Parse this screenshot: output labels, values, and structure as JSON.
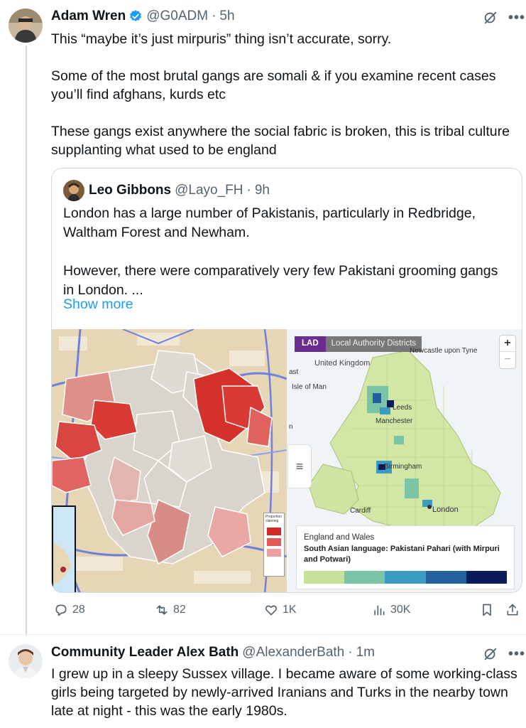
{
  "tweet": {
    "author_name": "Adam Wren",
    "handle": "@G0ADM",
    "separator": "·",
    "time": "5h",
    "paragraphs": [
      "This “maybe it’s just mirpuris” thing isn’t accurate, sorry.",
      "Some of the most brutal gangs are somali & if you examine recent cases you’ll find afghans, kurds etc",
      "These gangs exist anywhere the social fabric is broken, this is tribal culture supplanting what used to be england"
    ],
    "more_icon": "•••"
  },
  "quote": {
    "author_name": "Leo Gibbons",
    "handle": "@Layo_FH",
    "separator": "·",
    "time": "9h",
    "paragraphs": [
      "London has a large number of Pakistanis, particularly in Redbridge, Waltham Forest and Newham.",
      "However, there were comparatively very few Pakistani grooming gangs in London. ..."
    ],
    "show_more": "Show more",
    "map_left": {
      "legend_label": "Proportion claiming",
      "colors": [
        "#d42a2a",
        "#e05a5a",
        "#eaa0a0"
      ]
    },
    "map_right": {
      "lad_tag": "LAD",
      "lad_name": "Local Authority Districts",
      "zoom_in": "+",
      "zoom_out": "−",
      "menu_icon": "≡",
      "places": {
        "newcastle": "Newcastle upon Tyne",
        "uk": "United Kingdom",
        "ast": "ast",
        "isle_of_man": "Isle of Man",
        "n": "n",
        "leeds": "Leeds",
        "manchester": "Manchester",
        "birmingham": "Birmingham",
        "cardiff": "Cardiff",
        "london": "London"
      },
      "legend_title": "England and Wales",
      "legend_subtitle": "South Asian language: Pakistani Pahari (with Mirpuri and Potwari)",
      "scale_colors": [
        "#c6e29a",
        "#7cc4a6",
        "#3a9cc0",
        "#245f9e",
        "#0b1a5a"
      ]
    }
  },
  "actions": {
    "replies": "28",
    "reposts": "82",
    "likes": "1K",
    "views": "30K"
  },
  "reply": {
    "author_name": "Community Leader Alex Bath",
    "handle": "@AlexanderBath",
    "separator": "·",
    "time": "1m",
    "text": "I grew up in a sleepy Sussex village. I became aware of some working-class girls being targeted by newly-arrived Iranians and Turks in the nearby town late at night - this was the early 1980s.",
    "more_icon": "•••"
  },
  "colors": {
    "link_blue": "#1d9bf0",
    "verified_blue": "#1d9bf0",
    "muted": "#536471"
  }
}
